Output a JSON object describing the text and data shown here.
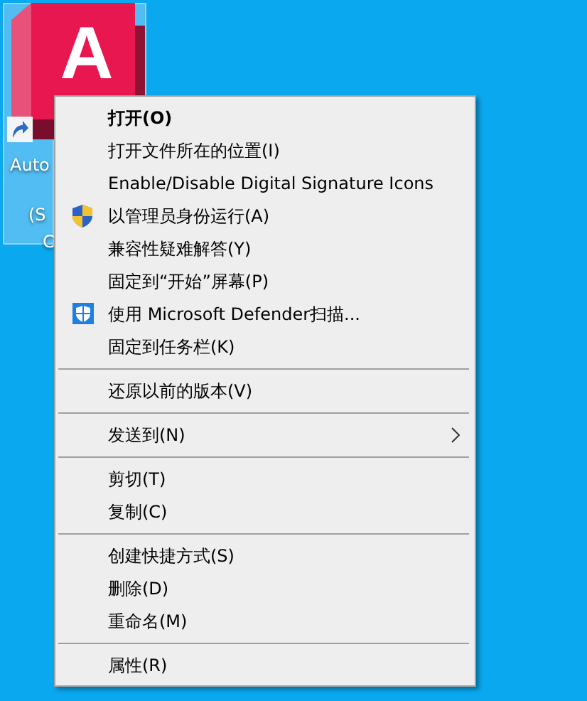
{
  "desktop_icon": {
    "selected": true,
    "logo_letter": "A",
    "label_lines": [
      "Auto",
      "(S",
      "C"
    ]
  },
  "context_menu": {
    "items": [
      {
        "kind": "item",
        "label": "打开(O)",
        "bold": true
      },
      {
        "kind": "item",
        "label": "打开文件所在的位置(I)"
      },
      {
        "kind": "item",
        "label": "Enable/Disable Digital Signature Icons"
      },
      {
        "kind": "elevated",
        "label": "以管理员身份运行(A)"
      },
      {
        "kind": "item",
        "label": "兼容性疑难解答(Y)"
      },
      {
        "kind": "item",
        "label": "固定到“开始”屏幕(P)"
      },
      {
        "kind": "scan",
        "label": "使用 Microsoft Defender扫描..."
      },
      {
        "kind": "item",
        "label": "固定到任务栏(K)"
      },
      {
        "kind": "separator"
      },
      {
        "kind": "item",
        "label": "还原以前的版本(V)"
      },
      {
        "kind": "separator"
      },
      {
        "kind": "submenu",
        "label": "发送到(N)"
      },
      {
        "kind": "separator"
      },
      {
        "kind": "item",
        "label": "剪切(T)"
      },
      {
        "kind": "item",
        "label": "复制(C)"
      },
      {
        "kind": "separator"
      },
      {
        "kind": "item",
        "label": "创建快捷方式(S)"
      },
      {
        "kind": "item",
        "label": "删除(D)"
      },
      {
        "kind": "item",
        "label": "重命名(M)"
      },
      {
        "kind": "separator"
      },
      {
        "kind": "item",
        "label": "属性(R)"
      }
    ]
  }
}
